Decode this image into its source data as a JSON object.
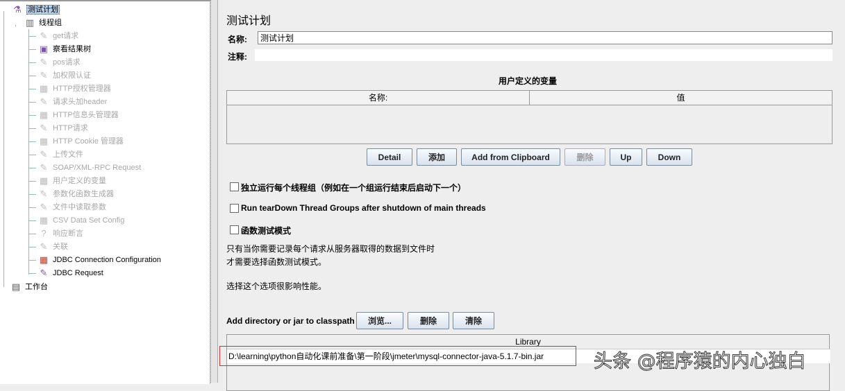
{
  "tree": {
    "root": "测试计划",
    "thread_group": "线程组",
    "children": [
      {
        "label": "get请求",
        "icon": "sampler-icon",
        "enabled": false
      },
      {
        "label": "察看结果树",
        "icon": "listener-icon",
        "enabled": true
      },
      {
        "label": "pos请求",
        "icon": "sampler-icon",
        "enabled": false
      },
      {
        "label": "加权限认证",
        "icon": "sampler-icon",
        "enabled": false
      },
      {
        "label": "HTTP授权管理器",
        "icon": "config-icon",
        "enabled": false
      },
      {
        "label": "请求头加header",
        "icon": "sampler-icon",
        "enabled": false
      },
      {
        "label": "HTTP信息头管理器",
        "icon": "config-icon",
        "enabled": false
      },
      {
        "label": "HTTP请求",
        "icon": "sampler-icon",
        "enabled": false
      },
      {
        "label": "HTTP Cookie 管理器",
        "icon": "config-icon",
        "enabled": false
      },
      {
        "label": "上传文件",
        "icon": "sampler-icon",
        "enabled": false
      },
      {
        "label": "SOAP/XML-RPC Request",
        "icon": "sampler-icon",
        "enabled": false
      },
      {
        "label": "用户定义的变量",
        "icon": "config-icon",
        "enabled": false
      },
      {
        "label": "参数化函数生成器",
        "icon": "sampler-icon",
        "enabled": false
      },
      {
        "label": "文件中读取参数",
        "icon": "sampler-icon",
        "enabled": false
      },
      {
        "label": "CSV Data Set Config",
        "icon": "config-icon",
        "enabled": false
      },
      {
        "label": "响应断言",
        "icon": "assertion-icon",
        "enabled": false
      },
      {
        "label": "关联",
        "icon": "sampler-icon",
        "enabled": false
      },
      {
        "label": "JDBC Connection Configuration",
        "icon": "config-icon",
        "enabled": true
      },
      {
        "label": "JDBC Request",
        "icon": "sampler-icon",
        "enabled": true
      }
    ],
    "workbench": "工作台"
  },
  "main": {
    "title": "测试计划",
    "name_label": "名称:",
    "name_value": "测试计划",
    "comment_label": "注释:",
    "comment_value": "",
    "vars_title": "用户定义的变量",
    "vars_cols": [
      "名称:",
      "值"
    ],
    "buttons": {
      "detail": "Detail",
      "add": "添加",
      "clipboard": "Add from Clipboard",
      "delete": "删除",
      "up": "Up",
      "down": "Down"
    },
    "checkbox1": "独立运行每个线程组（例如在一个组运行结束后启动下一个）",
    "checkbox2": "Run tearDown Thread Groups after shutdown of main threads",
    "checkbox3": "函数测试模式",
    "note1": "只有当你需要记录每个请求从服务器取得的数据到文件时",
    "note2": "才需要选择函数测试模式。",
    "note3": "选择这个选项很影响性能。",
    "classpath_label": "Add directory or jar to classpath",
    "classpath_buttons": {
      "browse": "浏览...",
      "delete": "删除",
      "clear": "清除"
    },
    "library_header": "Library",
    "library_rows": [
      "D:\\learning\\python自动化课前准备\\第一阶段\\jmeter\\mysql-connector-java-5.1.7-bin.jar"
    ]
  },
  "watermark": "头条 @程序猿的内心独白"
}
